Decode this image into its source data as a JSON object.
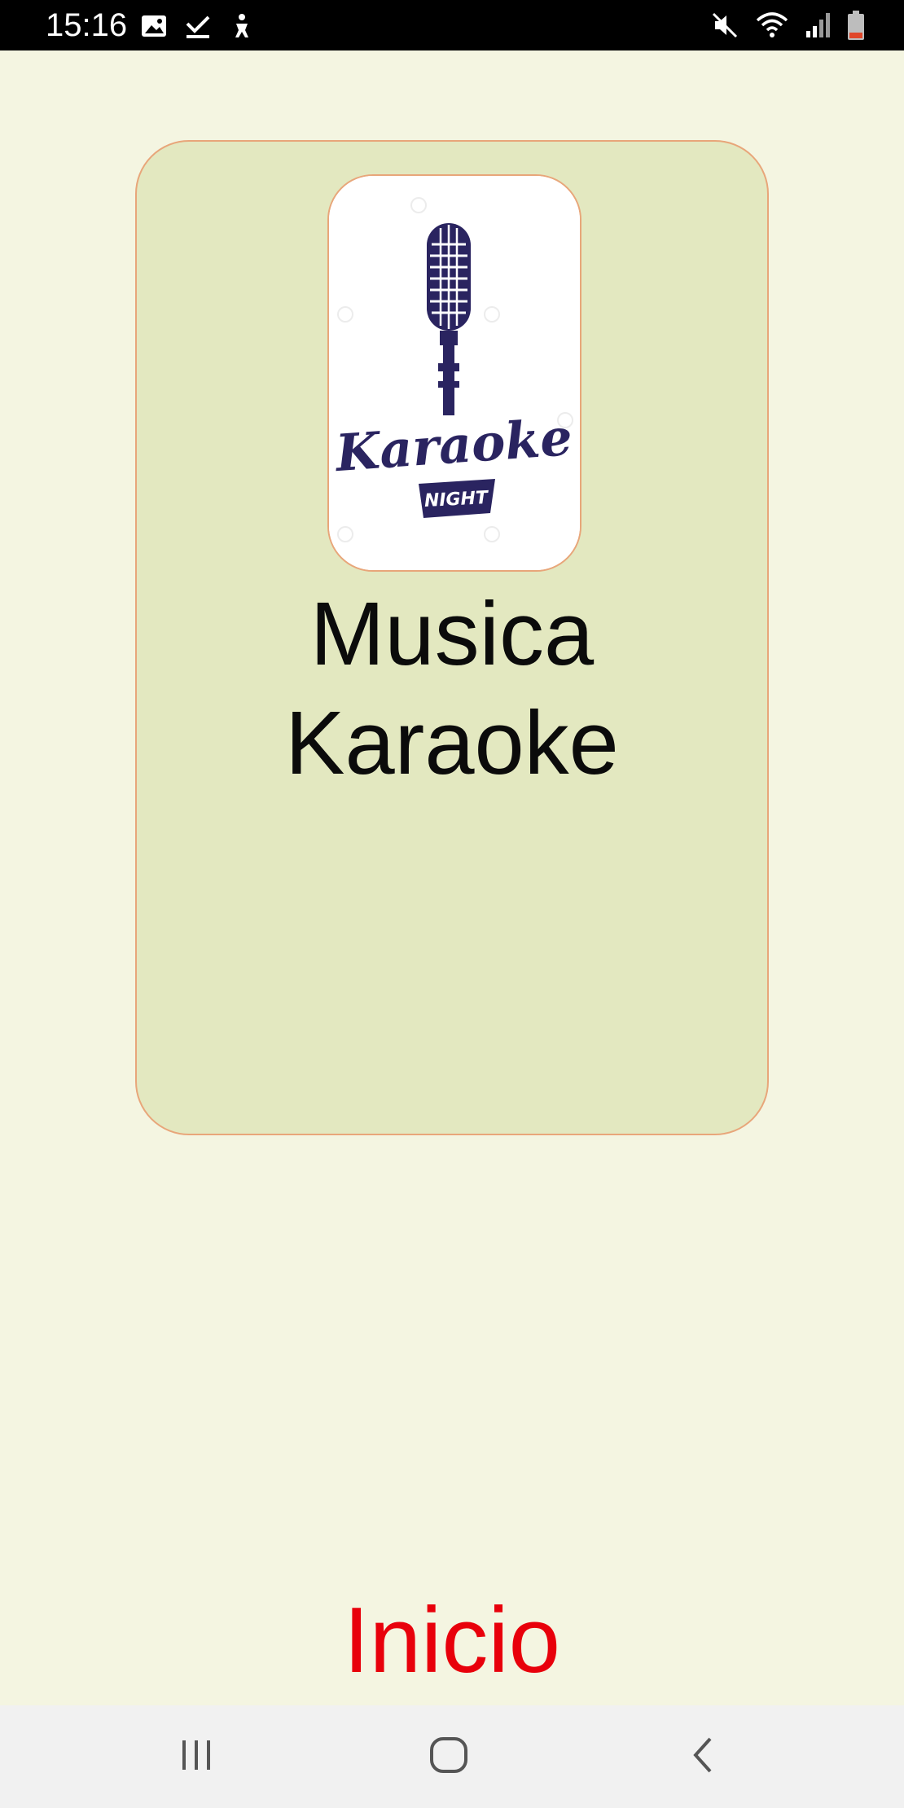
{
  "status_bar": {
    "time": "15:16",
    "left_icons": [
      "image-icon",
      "download-done-icon",
      "accessibility-icon"
    ],
    "right_icons": [
      "mute-icon",
      "wifi-icon",
      "signal-icon",
      "battery-icon"
    ]
  },
  "card": {
    "logo_text_main": "Karaoke",
    "logo_text_sub": "NIGHT",
    "title": "Musica Karaoke"
  },
  "start_button": {
    "label": "Inicio"
  },
  "nav_bar": {
    "buttons": [
      "recent-apps",
      "home",
      "back"
    ]
  },
  "colors": {
    "background": "#f4f5e1",
    "card_background": "#e3e8c0",
    "card_border": "#e8a67a",
    "start_text": "#e8000b",
    "logo_ink": "#2a2460"
  }
}
